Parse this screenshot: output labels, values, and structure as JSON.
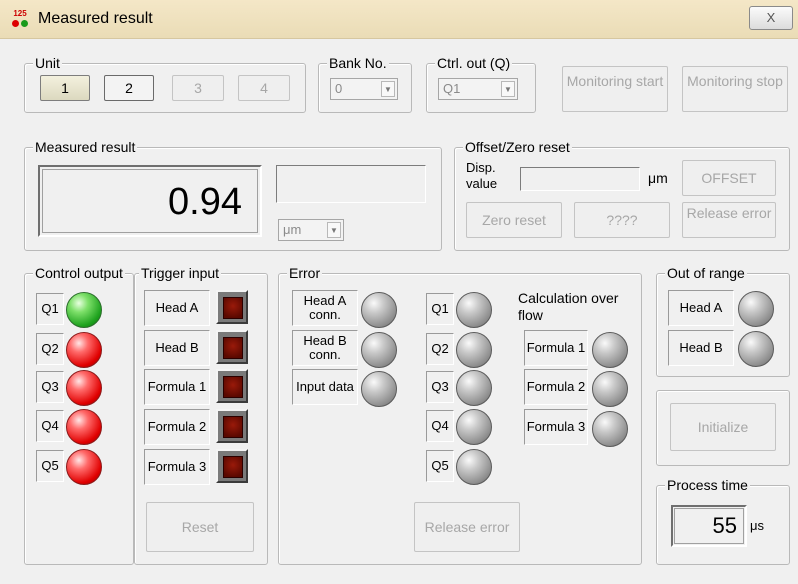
{
  "window": {
    "title": "Measured result",
    "close_glyph": "X",
    "icon_text": "125"
  },
  "unit": {
    "label": "Unit",
    "buttons": [
      "1",
      "2",
      "3",
      "4"
    ]
  },
  "bank": {
    "label": "Bank No.",
    "value": "0"
  },
  "ctrl_out": {
    "label": "Ctrl. out (Q)",
    "value": "Q1"
  },
  "monitoring": {
    "start": "Monitoring start",
    "stop": "Monitoring stop"
  },
  "measured": {
    "label": "Measured result",
    "value": "0.94",
    "unit": "μm"
  },
  "offset": {
    "label": "Offset/Zero reset",
    "disp_label": "Disp. value",
    "unit": "μm",
    "offset_btn": "OFFSET",
    "zero_reset_btn": "Zero reset",
    "qqq_btn": "????",
    "release_error_btn": "Release error"
  },
  "control_output": {
    "label": "Control output",
    "items": [
      {
        "name": "Q1",
        "state": "green"
      },
      {
        "name": "Q2",
        "state": "red"
      },
      {
        "name": "Q3",
        "state": "red"
      },
      {
        "name": "Q4",
        "state": "red"
      },
      {
        "name": "Q5",
        "state": "red"
      }
    ]
  },
  "trigger_input": {
    "label": "Trigger input",
    "items": [
      "Head A",
      "Head B",
      "Formula 1",
      "Formula 2",
      "Formula 3"
    ],
    "reset_btn": "Reset"
  },
  "error": {
    "label": "Error",
    "conn_items": [
      "Head A conn.",
      "Head B conn.",
      "Input data"
    ],
    "q_items": [
      "Q1",
      "Q2",
      "Q3",
      "Q4",
      "Q5"
    ],
    "calc_label": "Calculation over flow",
    "formula_items": [
      "Formula 1",
      "Formula 2",
      "Formula 3"
    ],
    "release_btn": "Release error"
  },
  "out_of_range": {
    "label": "Out of range",
    "items": [
      "Head A",
      "Head B"
    ]
  },
  "initialize": {
    "label": "Initialize"
  },
  "process_time": {
    "label": "Process time",
    "value": "55",
    "unit": "μs"
  },
  "colors": {
    "led_green": "#1ea21e",
    "led_red": "#e00000",
    "led_gray": "#8a8a8a",
    "title_bar": "#f4e7c7"
  }
}
